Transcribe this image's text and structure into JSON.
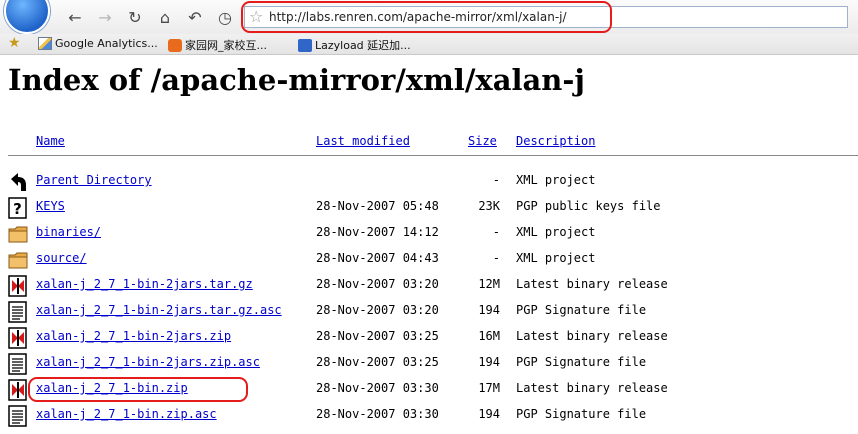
{
  "browser": {
    "url": "http://labs.renren.com/apache-mirror/xml/xalan-j/",
    "bookmarks": [
      {
        "label": "Google Analytics...",
        "icon": "google-analytics-icon"
      },
      {
        "label": "家园网_家校互...",
        "icon": "jiayuan-icon"
      },
      {
        "label": "Lazyload 延迟加...",
        "icon": "lazyload-icon"
      }
    ]
  },
  "page": {
    "title": "Index of /apache-mirror/xml/xalan-j",
    "columns": {
      "name": "Name",
      "last_modified": "Last modified",
      "size": "Size",
      "description": "Description"
    },
    "rows": [
      {
        "icon": "back-icon",
        "name": "Parent Directory",
        "date": "",
        "size": "-",
        "desc": "XML project"
      },
      {
        "icon": "unknown-icon",
        "name": "KEYS",
        "date": "28-Nov-2007 05:48",
        "size": "23K",
        "desc": "PGP public keys file"
      },
      {
        "icon": "folder-icon",
        "name": "binaries/",
        "date": "28-Nov-2007 14:12",
        "size": "-",
        "desc": "XML project"
      },
      {
        "icon": "folder-icon",
        "name": "source/",
        "date": "28-Nov-2007 04:43",
        "size": "-",
        "desc": "XML project"
      },
      {
        "icon": "binary-icon",
        "name": "xalan-j_2_7_1-bin-2jars.tar.gz",
        "date": "28-Nov-2007 03:20",
        "size": "12M",
        "desc": "Latest binary release"
      },
      {
        "icon": "text-icon",
        "name": "xalan-j_2_7_1-bin-2jars.tar.gz.asc",
        "date": "28-Nov-2007 03:20",
        "size": "194",
        "desc": "PGP Signature file"
      },
      {
        "icon": "binary-icon",
        "name": "xalan-j_2_7_1-bin-2jars.zip",
        "date": "28-Nov-2007 03:25",
        "size": "16M",
        "desc": "Latest binary release"
      },
      {
        "icon": "text-icon",
        "name": "xalan-j_2_7_1-bin-2jars.zip.asc",
        "date": "28-Nov-2007 03:25",
        "size": "194",
        "desc": "PGP Signature file"
      },
      {
        "icon": "binary-icon",
        "name": "xalan-j_2_7_1-bin.zip",
        "date": "28-Nov-2007 03:30",
        "size": "17M",
        "desc": "Latest binary release"
      },
      {
        "icon": "text-icon",
        "name": "xalan-j_2_7_1-bin.zip.asc",
        "date": "28-Nov-2007 03:30",
        "size": "194",
        "desc": "PGP Signature file"
      }
    ]
  },
  "colors": {
    "link": "#0000cc",
    "highlight": "#e41c1c"
  }
}
